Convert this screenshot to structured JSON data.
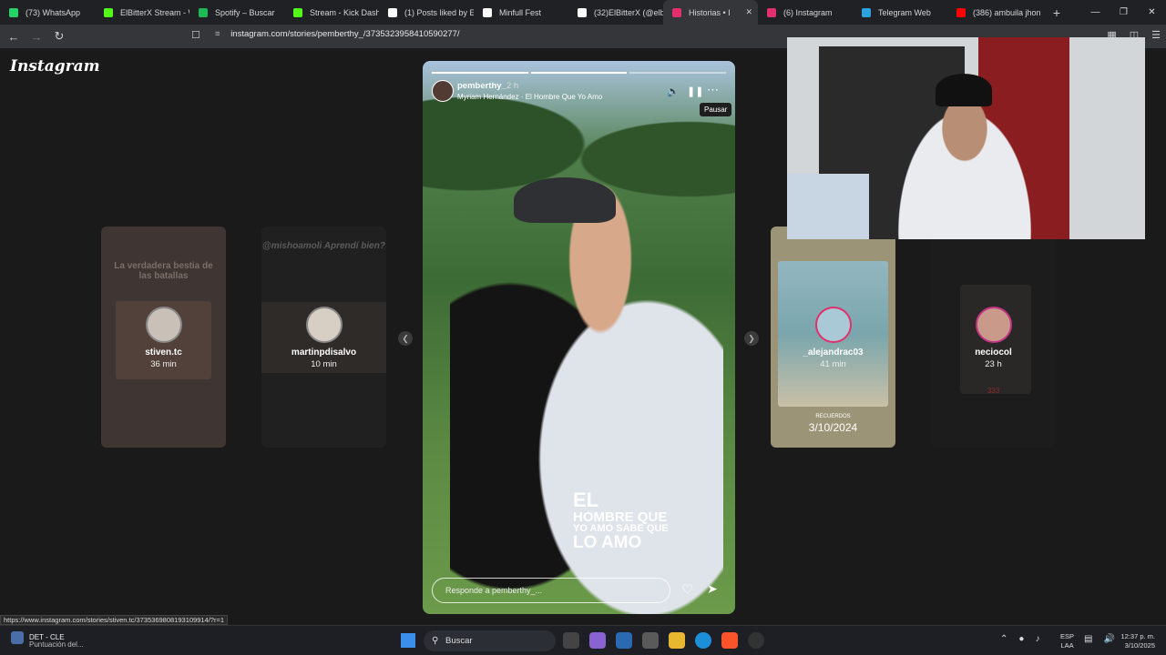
{
  "browser": {
    "tabs": [
      {
        "label": "(73) WhatsApp",
        "color": "#25d366"
      },
      {
        "label": "ElBitterX Stream - W",
        "color": "#53fc18"
      },
      {
        "label": "Spotify – Buscar",
        "color": "#1db954"
      },
      {
        "label": "Stream - Kick Dashb",
        "color": "#53fc18"
      },
      {
        "label": "(1) Posts liked by El",
        "color": "#ffffff"
      },
      {
        "label": "Minfull Fest",
        "color": "#ffffff"
      },
      {
        "label": "(32)ElBitterX (@elbi",
        "color": "#ffffff"
      },
      {
        "label": "Historias • I",
        "color": "#e1306c",
        "active": true
      },
      {
        "label": "(6) Instagram",
        "color": "#e1306c"
      },
      {
        "label": "Telegram Web",
        "color": "#2aa3df"
      },
      {
        "label": "(386) ambuila jhon",
        "color": "#ff0000"
      }
    ],
    "url": "instagram.com/stories/pemberthy_/3735323958410590277/",
    "status_url": "https://www.instagram.com/stories/stiven.tc/3735369808193109914/?r=1"
  },
  "instagram": {
    "logo": "Instagram",
    "side_stories": [
      {
        "username": "stiven.tc",
        "time": "36 min",
        "text": "La verdadera bestia de las batallas"
      },
      {
        "username": "martinpdisalvo",
        "time": "10 min",
        "text": "@mishoamoli Aprendí bien?"
      },
      {
        "username": "_alejandrac03",
        "time": "41 min",
        "small": "RECUERDOS",
        "date": "3/10/2024"
      },
      {
        "username": "neciocol",
        "time": "23 h",
        "text": "333"
      }
    ],
    "story": {
      "username": "pemberthy_",
      "time": "2 h",
      "song": "Myriam Hernández · El Hombre Que Yo Amo",
      "tooltip": "Pausar",
      "caption": [
        "EL",
        "HOMBRE QUE",
        "YO AMO SABE QUE",
        "LO AMO"
      ],
      "reply_placeholder": "Responde a pemberthy_...",
      "progress_segments": [
        1,
        1,
        0
      ]
    }
  },
  "taskbar": {
    "weather_title": "DET - CLE",
    "weather_sub": "Puntuación del...",
    "search_placeholder": "Buscar",
    "lang_1": "ESP",
    "lang_2": "LAA",
    "time": "12:37 p. m.",
    "date": "3/10/2025"
  }
}
